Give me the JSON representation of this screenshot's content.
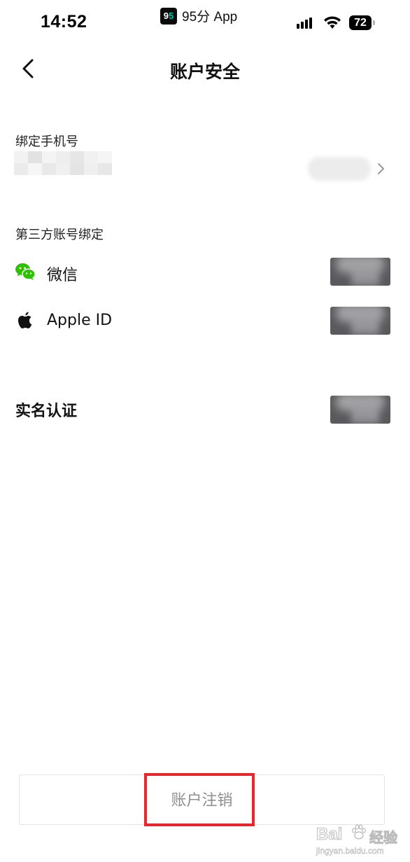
{
  "status_bar": {
    "time": "14:52",
    "app_logo_text_main": "9",
    "app_logo_text_accent": "5",
    "app_name": "95分 App",
    "battery_level": "72",
    "icons": [
      "signal-icon",
      "wifi-icon",
      "battery-icon"
    ]
  },
  "nav": {
    "title": "账户安全",
    "back_icon": "chevron-left-icon"
  },
  "phone": {
    "label": "绑定手机号",
    "value_obscured": true,
    "status_obscured": true
  },
  "third_party": {
    "label": "第三方账号绑定",
    "items": [
      {
        "name": "微信",
        "icon": "wechat-icon",
        "button_obscured": true
      },
      {
        "name": "Apple ID",
        "icon": "apple-icon",
        "button_obscured": true
      }
    ]
  },
  "real_name": {
    "label": "实名认证",
    "button_obscured": true
  },
  "bottom": {
    "cancel_label": "账户注销"
  },
  "watermark": {
    "brand": "Bai",
    "brand_cn": "经验",
    "url": "jingyan.baidu.com"
  },
  "colors": {
    "highlight_border": "#e8262b",
    "wechat_green": "#2dc100",
    "bind_button_bg": "#5a5a5e",
    "cancel_text": "#8e8e8e"
  }
}
